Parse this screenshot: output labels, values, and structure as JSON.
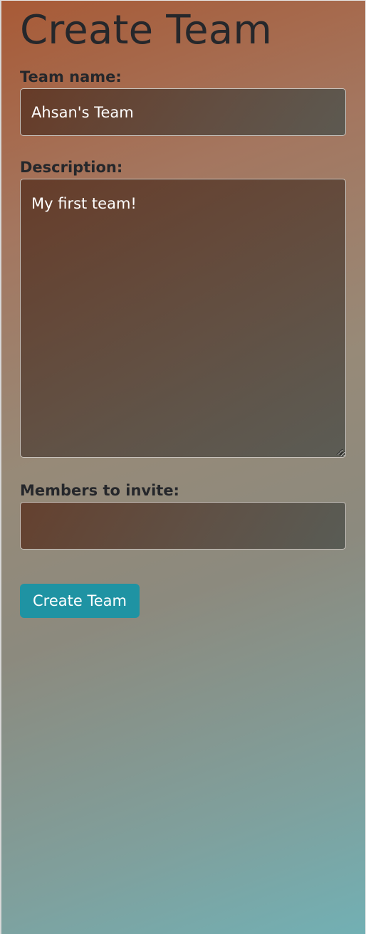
{
  "page": {
    "title": "Create Team"
  },
  "form": {
    "team_name": {
      "label": "Team name:",
      "value": "Ahsan's Team"
    },
    "description": {
      "label": "Description:",
      "value": "My first team!"
    },
    "members": {
      "label": "Members to invite:",
      "value": ""
    },
    "submit_label": "Create Team"
  },
  "colors": {
    "button": "#1f93a3",
    "heading_text": "#25272b",
    "gradient_start": "#a85a36",
    "gradient_end": "#72b0b4"
  },
  "icons": {
    "resize": "resize-handle-icon"
  }
}
